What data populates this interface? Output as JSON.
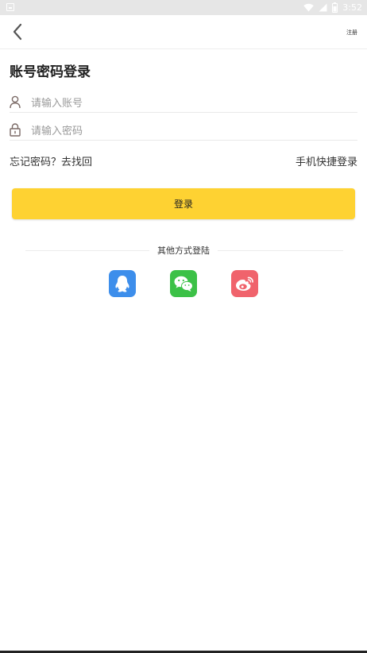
{
  "status_bar": {
    "time": "3:52",
    "icons": [
      "notification-icon",
      "wifi-icon",
      "signal-icon",
      "battery-icon"
    ]
  },
  "nav": {
    "back_icon": "chevron-left-icon",
    "register_label": "注册"
  },
  "page_title": "账号密码登录",
  "form": {
    "account": {
      "icon": "user-icon",
      "placeholder": "请输入账号",
      "value": ""
    },
    "password": {
      "icon": "lock-icon",
      "placeholder": "请输入密码",
      "value": ""
    }
  },
  "links": {
    "forgot": "忘记密码？去找回",
    "quick_login": "手机快捷登录"
  },
  "login_button": "登录",
  "other_methods": {
    "label": "其他方式登陆",
    "items": [
      {
        "icon": "qq-icon",
        "color": "#3d8eeb"
      },
      {
        "icon": "wechat-icon",
        "color": "#3cc147"
      },
      {
        "icon": "weibo-icon",
        "color": "#f0636c"
      }
    ]
  },
  "colors": {
    "accent": "#fed232",
    "status_bar": "#e6e6e6",
    "placeholder": "#9a9a9a"
  }
}
